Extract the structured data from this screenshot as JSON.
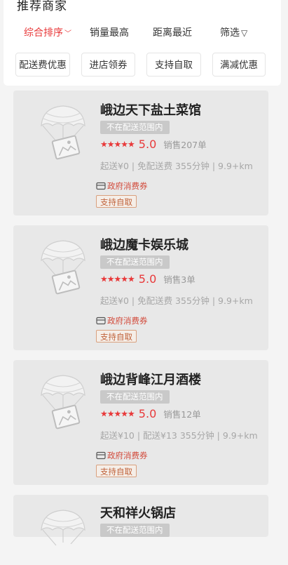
{
  "section": {
    "title": "推荐商家"
  },
  "sort_bar": {
    "items": [
      "综合排序",
      "销量最高",
      "距离最近",
      "筛选"
    ],
    "active_color": "#e8393a"
  },
  "chips": [
    "配送费优惠",
    "进店领券",
    "支持自取",
    "满减优惠"
  ],
  "stores": [
    {
      "name": "峨边天下盐土菜馆",
      "status": "不在配送范围内",
      "stars": "★★★★★",
      "score": "5.0",
      "sales": "销售207单",
      "delivery": "起送¥0 | 免配送费  355分钟 | 9.9+km",
      "voucher": "政府消费券",
      "pickup": "支持自取"
    },
    {
      "name": "峨边魔卡娱乐城",
      "status": "不在配送范围内",
      "stars": "★★★★★",
      "score": "5.0",
      "sales": "销售3单",
      "delivery": "起送¥0 | 免配送费  355分钟 | 9.9+km",
      "voucher": "政府消费券",
      "pickup": "支持自取"
    },
    {
      "name": "峨边背峰江月酒楼",
      "status": "不在配送范围内",
      "stars": "★★★★★",
      "score": "5.0",
      "sales": "销售12单",
      "delivery": "起送¥10 | 配送¥13  355分钟 | 9.9+km",
      "voucher": "政府消费券",
      "pickup": "支持自取"
    },
    {
      "name": "天和祥火锅店",
      "status": "不在配送范围内"
    }
  ]
}
